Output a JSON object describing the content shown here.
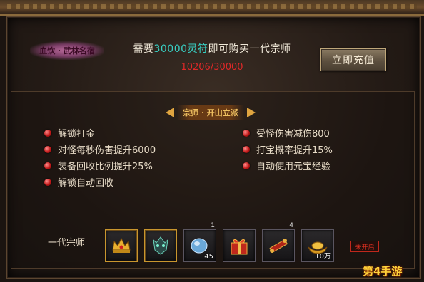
{
  "header": {
    "rank_name": "血饮 · 武林名宿",
    "require_prefix": "需要",
    "require_amount": "30000灵符",
    "require_suffix": "即可购买一代宗师",
    "progress": "10206/30000",
    "recharge_label": "立即充值"
  },
  "section": {
    "title": "宗师 · 开山立派"
  },
  "perks_left": [
    "解锁打金",
    "对怪每秒伤害提升6000",
    "装备回收比例提升25%",
    "解锁自动回收"
  ],
  "perks_right": [
    "受怪伤害减伤800",
    "打宝概率提升15%",
    "自动使用元宝经验"
  ],
  "rewards": {
    "label": "一代宗师",
    "items": [
      {
        "icon": "golden-crown-icon",
        "count": "",
        "badge": ""
      },
      {
        "icon": "green-skull-helm-icon",
        "count": "",
        "badge": ""
      },
      {
        "icon": "blue-gem-icon",
        "count": "45",
        "badge": "1"
      },
      {
        "icon": "red-gift-box-icon",
        "count": "",
        "badge": ""
      },
      {
        "icon": "red-scroll-icon",
        "count": "",
        "badge": "4"
      },
      {
        "icon": "gold-ingot-icon",
        "count": "10万",
        "badge": ""
      }
    ],
    "status": "未开启"
  },
  "watermark": "第4手游",
  "colors": {
    "accent_cyan": "#38d0c4",
    "progress_red": "#e02828",
    "gold": "#e0a540"
  }
}
